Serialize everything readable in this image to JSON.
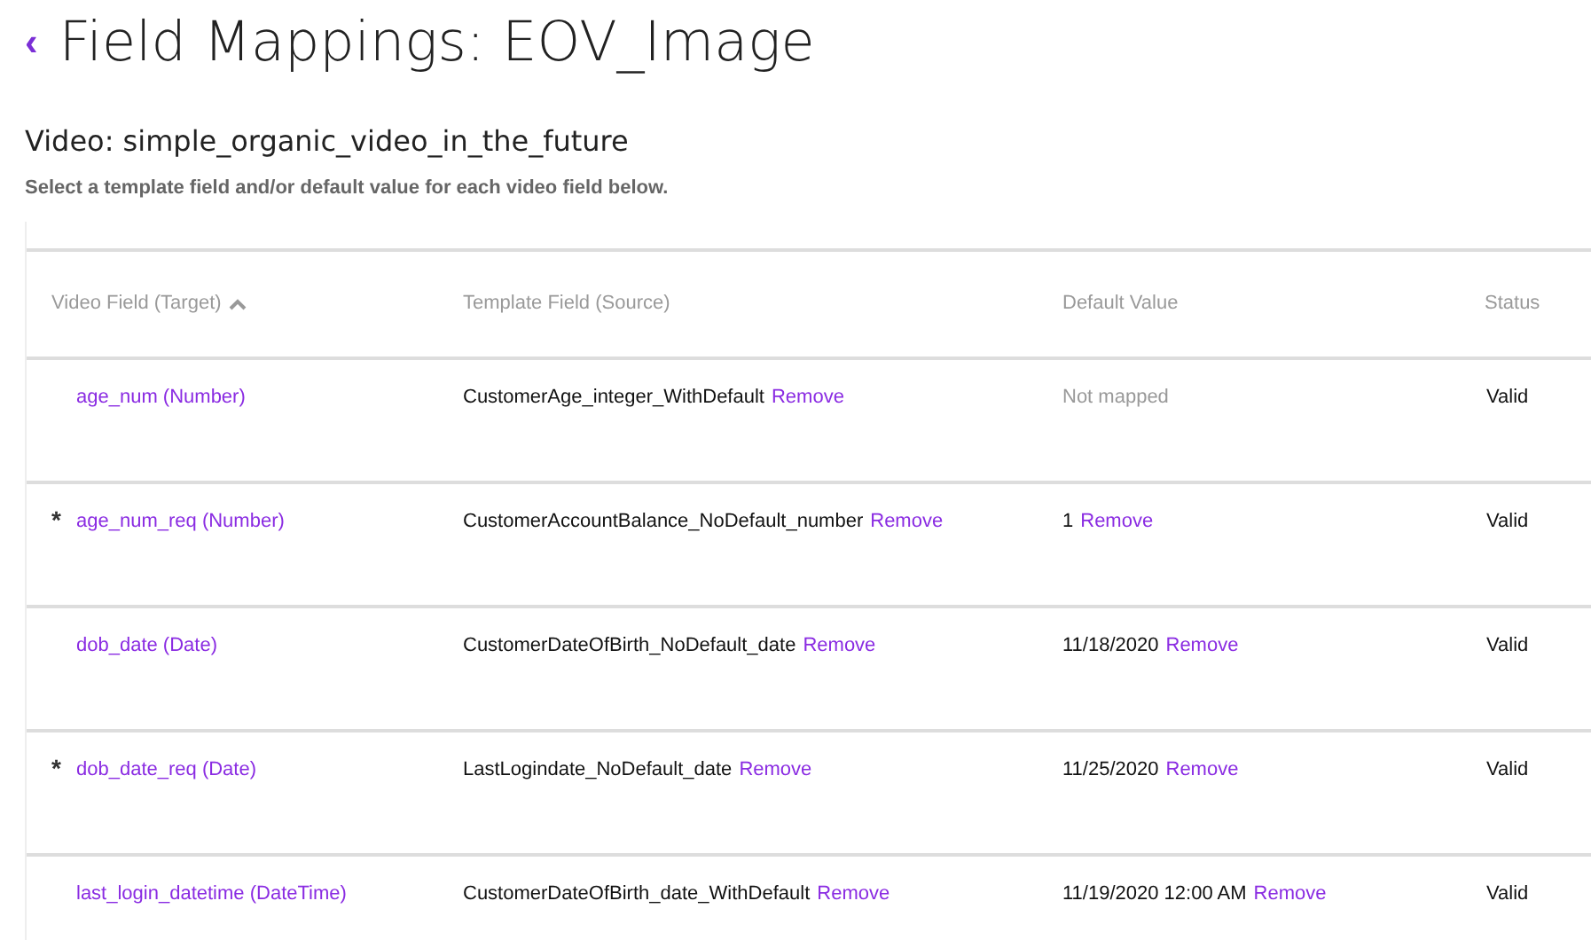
{
  "page": {
    "back": "‹",
    "title": "Field Mappings: EOV_Image"
  },
  "video": {
    "title": "Video: simple_organic_video_in_the_future",
    "hint": "Select a template field and/or default value for each video field below."
  },
  "table": {
    "columns": [
      {
        "label": "Video Field (Target)",
        "sorted": true
      },
      {
        "label": "Template Field (Source)",
        "sorted": false
      },
      {
        "label": "Default Value",
        "sorted": false
      },
      {
        "label": "Status",
        "sorted": false
      }
    ],
    "rows": [
      {
        "target": "age_num (Number)",
        "source": "CustomerAge_integer_WithDefault",
        "source_action": "Remove",
        "default": {
          "kind": "empty",
          "text": "Not mapped"
        },
        "status": "Valid"
      },
      {
        "marker": "*",
        "target": "age_num_req (Number)",
        "source": "CustomerAccountBalance_NoDefault_number",
        "source_action": "Remove",
        "default": {
          "kind": "value",
          "text": "1",
          "action": "Remove"
        },
        "status": "Valid"
      },
      {
        "target": "dob_date (Date)",
        "source": "CustomerDateOfBirth_NoDefault_date",
        "source_action": "Remove",
        "default": {
          "kind": "value",
          "text": "11/18/2020",
          "action": "Remove"
        },
        "status": "Valid"
      },
      {
        "marker": "*",
        "target": "dob_date_req (Date)",
        "source": "LastLogindate_NoDefault_date",
        "source_action": "Remove",
        "default": {
          "kind": "value",
          "text": "11/25/2020",
          "action": "Remove"
        },
        "status": "Valid"
      },
      {
        "target": "last_login_datetime (DateTime)",
        "source": "CustomerDateOfBirth_date_WithDefault",
        "source_action": "Remove",
        "default": {
          "kind": "value",
          "text": "11/19/2020 12:00 AM",
          "action": "Remove"
        },
        "status": "Valid"
      }
    ]
  }
}
